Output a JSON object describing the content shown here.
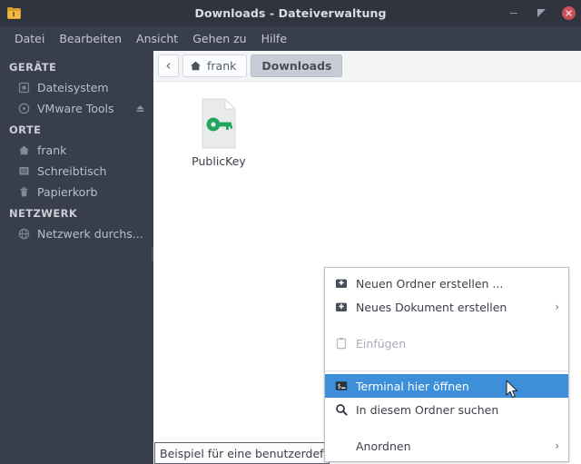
{
  "window": {
    "title": "Downloads - Dateiverwaltung",
    "app_icon": "folder-icon",
    "minimize_label": "−",
    "maximize_label": "□",
    "close_label": "×"
  },
  "menubar": {
    "items": [
      {
        "label": "Datei"
      },
      {
        "label": "Bearbeiten"
      },
      {
        "label": "Ansicht"
      },
      {
        "label": "Gehen zu"
      },
      {
        "label": "Hilfe"
      }
    ]
  },
  "sidebar": {
    "groups": [
      {
        "header": "GERÄTE",
        "items": [
          {
            "label": "Dateisystem",
            "icon": "drive-icon",
            "eject": false
          },
          {
            "label": "VMware Tools",
            "icon": "disc-icon",
            "eject": true
          }
        ]
      },
      {
        "header": "ORTE",
        "items": [
          {
            "label": "frank",
            "icon": "home-icon",
            "eject": false
          },
          {
            "label": "Schreibtisch",
            "icon": "desktop-icon",
            "eject": false
          },
          {
            "label": "Papierkorb",
            "icon": "trash-icon",
            "eject": false
          }
        ]
      },
      {
        "header": "NETZWERK",
        "items": [
          {
            "label": "Netzwerk durchs...",
            "icon": "globe-icon",
            "eject": false
          }
        ]
      }
    ]
  },
  "toolbar": {
    "back_label": "‹",
    "breadcrumbs": [
      {
        "label": "frank",
        "icon": "home-icon",
        "active": false
      },
      {
        "label": "Downloads",
        "icon": "",
        "active": true
      }
    ]
  },
  "content": {
    "files": [
      {
        "name": "PublicKey",
        "icon": "key-document-icon"
      }
    ]
  },
  "tooltip": {
    "text": "Beispiel für eine benutzerdef"
  },
  "context_menu": {
    "items": [
      {
        "label": "Neuen Ordner erstellen ...",
        "icon": "new-folder-icon",
        "submenu": false,
        "disabled": false,
        "selected": false,
        "gap_after": false
      },
      {
        "label": "Neues Dokument erstellen",
        "icon": "new-document-icon",
        "submenu": true,
        "disabled": false,
        "selected": false,
        "gap_after": true
      },
      {
        "label": "Einfügen",
        "icon": "paste-icon",
        "submenu": false,
        "disabled": true,
        "selected": false,
        "gap_after": false,
        "sep_after": true
      },
      {
        "label": "Terminal hier öffnen",
        "icon": "terminal-icon",
        "submenu": false,
        "disabled": false,
        "selected": true,
        "gap_after": false
      },
      {
        "label": "In diesem Ordner suchen",
        "icon": "search-icon",
        "submenu": false,
        "disabled": false,
        "selected": false,
        "gap_after": true
      },
      {
        "label": "Anordnen",
        "icon": "",
        "submenu": true,
        "disabled": false,
        "selected": false,
        "gap_after": false
      }
    ]
  },
  "colors": {
    "titlebar": "#2f343f",
    "sidebar": "#383e4b",
    "toolbar": "#f2f4f6",
    "accent_selection": "#3c8fd8",
    "close_button": "#c9505a",
    "key_green": "#1fa65a"
  }
}
